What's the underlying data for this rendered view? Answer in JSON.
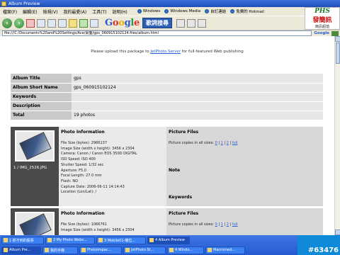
{
  "window": {
    "title": "Album Preview"
  },
  "menu": {
    "items": [
      "檔案(F)",
      "編輯(E)",
      "檢視(V)",
      "我的最愛(A)",
      "工具(T)",
      "說明(H)"
    ],
    "links": [
      "Windows",
      "Windows Media",
      "自訂連結",
      "免費的 Hotmail"
    ]
  },
  "toolbar": {
    "google": "Google",
    "web_search": "歌詞搜尋"
  },
  "address": {
    "url": "file:///C:/Documents%20and%20Settings/Ace/桌面/gps_060915102124.files/album.html",
    "google_label": "Google"
  },
  "banner": {
    "title": "PHS",
    "main": "發簡訊",
    "sub": "簡訊超值"
  },
  "notice": {
    "prefix": "Please upload this package to ",
    "link": "JetPhoto Server",
    "suffix": " for full-featured Web publishing"
  },
  "album": {
    "rows": [
      {
        "key": "Album Title",
        "value": "gps"
      },
      {
        "key": "Album Short Name",
        "value": "gps_060915102124"
      },
      {
        "key": "Keywords",
        "value": ""
      },
      {
        "key": "Description",
        "value": ""
      },
      {
        "key": "Total",
        "value": "19 photos"
      }
    ]
  },
  "photo1": {
    "label": "1 / IMG_2526.JPG",
    "info_title": "Photo Information",
    "lines": [
      "File Size (bytes): 2966137",
      "Image Size (width x height): 3456 x 2304",
      "Camera: Canon / Canon EOS 350D DIGITAL",
      "ISO Speed: ISO 400",
      "Shutter Speed: 1/32 sec",
      "Aperture: F5.0",
      "Focal Length: 27.0 mm",
      "Flash: NO",
      "Capture Date: 2006-06-11 14:14:43",
      "Location (Lon/Lat): /"
    ],
    "files_title": "Picture Files",
    "copies_prefix": "Picture copies in all sizes: ",
    "sizes": [
      "0",
      "1",
      "2",
      "full"
    ],
    "note_label": "Note",
    "keywords_label": "Keywords"
  },
  "photo2": {
    "info_title": "Photo Information",
    "lines": [
      "File Size (bytes): 1066761",
      "Image Size (width x height): 3456 x 2304"
    ],
    "files_title": "Picture Files",
    "copies_prefix": "Picture copies in all sizes: ",
    "sizes": [
      "0",
      "1",
      "2",
      "full"
    ]
  },
  "taskbar": {
    "row1": [
      "1 抓不到的股票",
      "2 My Photo Webs...",
      "3 Mobile01-機位...",
      "4 Album Preview"
    ],
    "row2": [
      "Album Pre...",
      "我的手機",
      "PhotoImpac...",
      "JetPhoto St...",
      "4 Windo...",
      "Macromed..."
    ]
  },
  "clock": "#63476"
}
